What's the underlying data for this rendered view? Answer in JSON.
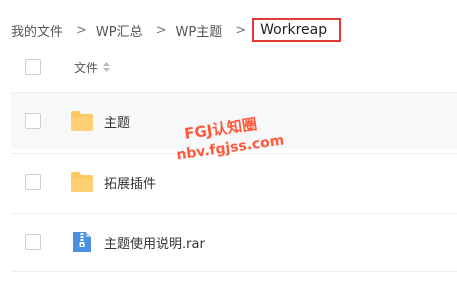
{
  "breadcrumb": {
    "items": [
      "我的文件",
      "WP汇总",
      "WP主题",
      "Workreap"
    ],
    "separator": ">"
  },
  "list": {
    "column_name": "文件",
    "rows": [
      {
        "name": "主题",
        "icon": "folder-icon"
      },
      {
        "name": "拓展插件",
        "icon": "folder-icon"
      },
      {
        "name": "主题使用说明.rar",
        "icon": "archive-icon"
      }
    ]
  },
  "watermark": {
    "line1": "FGJ认知圈",
    "line2": "nbv.fgjss.com"
  },
  "colors": {
    "highlight_border": "#e53935",
    "folder": "#ffc760",
    "archive": "#4a90e2",
    "watermark": "#ff5a3c"
  }
}
